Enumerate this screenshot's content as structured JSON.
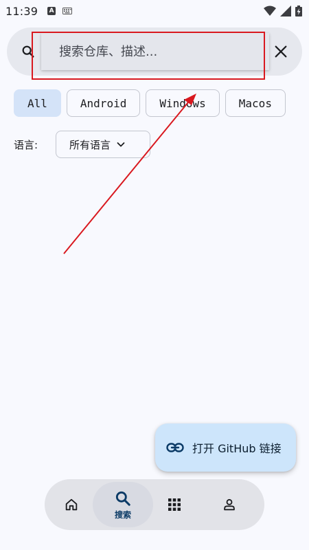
{
  "status_bar": {
    "time": "11:39",
    "left_icons": [
      "a-icon",
      "keyboard-icon"
    ],
    "right_icons": [
      "wifi-icon",
      "signal-icon",
      "battery-icon"
    ]
  },
  "search": {
    "placeholder": "搜索仓库、描述...",
    "value": ""
  },
  "chips": [
    {
      "label": "All",
      "selected": true
    },
    {
      "label": "Android",
      "selected": false
    },
    {
      "label": "Windows",
      "selected": false
    },
    {
      "label": "Macos",
      "selected": false
    }
  ],
  "language_filter": {
    "label": "语言:",
    "selected": "所有语言"
  },
  "fab": {
    "label": "打开 GitHub 链接",
    "icon": "link-icon"
  },
  "bottom_nav": {
    "items": [
      {
        "icon": "home-icon",
        "label": ""
      },
      {
        "icon": "search-icon",
        "label": "搜索",
        "active": true
      },
      {
        "icon": "apps-grid-icon",
        "label": ""
      },
      {
        "icon": "profile-icon",
        "label": ""
      }
    ]
  },
  "colors": {
    "background": "#f8f9fe",
    "annotation_red": "#d9181f",
    "chip_selected": "#d4e3f8",
    "fab_background": "#cde5fb",
    "nav_background": "#e2e3e8"
  }
}
